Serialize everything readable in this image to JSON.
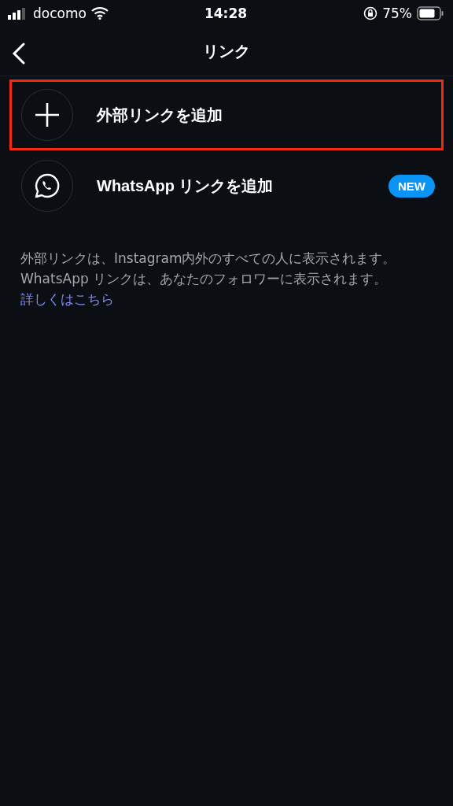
{
  "status_bar": {
    "carrier": "docomo",
    "time": "14:28",
    "battery": "75%"
  },
  "header": {
    "title": "リンク"
  },
  "options": [
    {
      "kind": "add",
      "label": "外部リンクを追加",
      "highlighted": true
    },
    {
      "kind": "whatsapp",
      "label": "WhatsApp リンクを追加",
      "badge": "NEW",
      "highlighted": false
    }
  ],
  "info": {
    "text": "外部リンクは、Instagram内外のすべての人に表示されます。WhatsApp リンクは、あなたのフォロワーに表示されます。",
    "link": "詳しくはこちら"
  }
}
